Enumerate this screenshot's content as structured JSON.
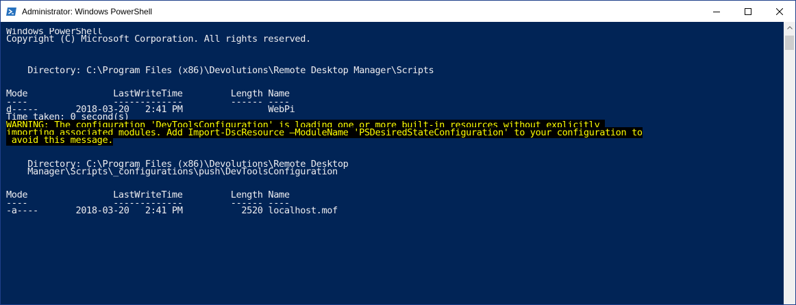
{
  "window": {
    "title": "Administrator: Windows PowerShell",
    "icon": "powershell-icon",
    "controls": [
      "minimize-icon",
      "maximize-icon",
      "close-icon"
    ]
  },
  "colors": {
    "console_bg": "#012456",
    "console_fg": "#eeedf0",
    "warning_fg": "#ffff00",
    "warning_bg": "#000000"
  },
  "console": {
    "lines": [
      {
        "text": "Windows PowerShell"
      },
      {
        "text": "Copyright (C) Microsoft Corporation. All rights reserved."
      },
      {
        "text": ""
      },
      {
        "text": ""
      },
      {
        "text": ""
      },
      {
        "text": "    Directory: C:\\Program Files (x86)\\Devolutions\\Remote Desktop Manager\\Scripts"
      },
      {
        "text": ""
      },
      {
        "text": ""
      },
      {
        "text": "Mode                LastWriteTime         Length Name"
      },
      {
        "text": "----                -------------         ------ ----"
      },
      {
        "text": "d-----       2018-03-20   2:41 PM                WebPi"
      },
      {
        "text": "Time taken: 0 second(s)"
      },
      {
        "text": "WARNING: The configuration 'DevToolsConfiguration' is loading one or more built-in resources without explicitly ",
        "warning": true
      },
      {
        "text": "importing associated modules. Add Import-DscResource –ModuleName 'PSDesiredStateConfiguration' to your configuration to",
        "warning": true
      },
      {
        "text": " avoid this message.",
        "warning": true
      },
      {
        "text": ""
      },
      {
        "text": ""
      },
      {
        "text": "    Directory: C:\\Program Files (x86)\\Devolutions\\Remote Desktop"
      },
      {
        "text": "    Manager\\Scripts\\_configurations\\push\\DevToolsConfiguration"
      },
      {
        "text": ""
      },
      {
        "text": ""
      },
      {
        "text": "Mode                LastWriteTime         Length Name"
      },
      {
        "text": "----                -------------         ------ ----"
      },
      {
        "text": "-a----       2018-03-20   2:41 PM           2520 localhost.mof"
      }
    ]
  }
}
